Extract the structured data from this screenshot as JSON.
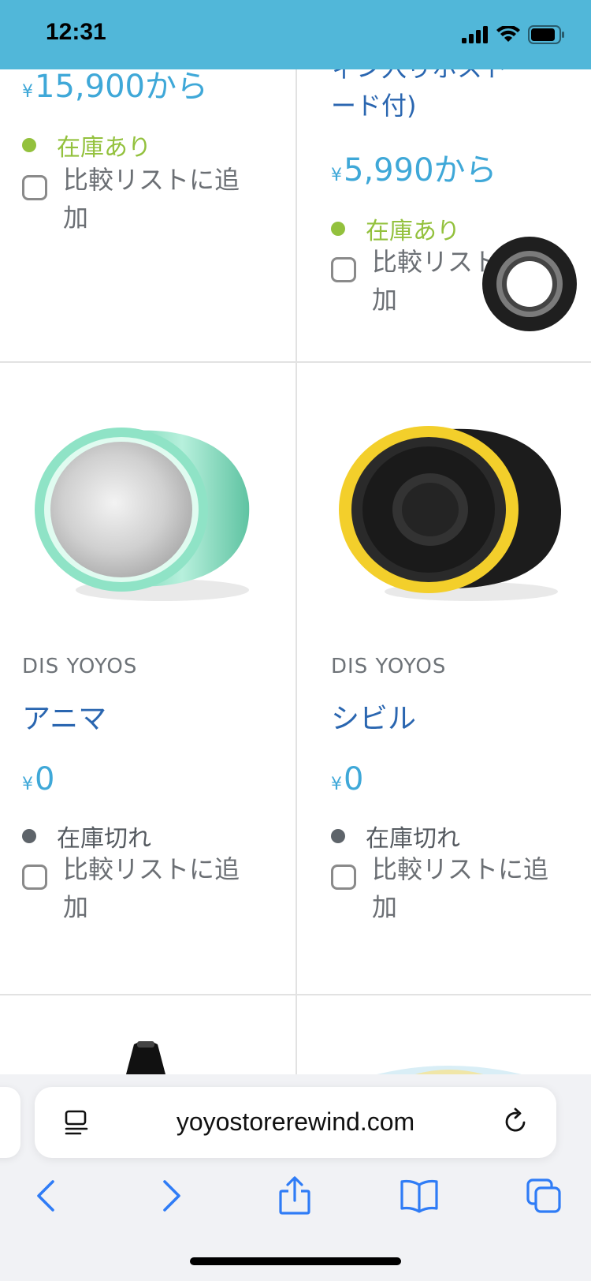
{
  "status_bar": {
    "time": "12:31"
  },
  "products": {
    "top_left": {
      "price_symbol": "¥",
      "price": "15,900から",
      "stock": "在庫あり",
      "compare_label": "比較リストに追加"
    },
    "top_right": {
      "name_partial_line1": "ィン入りホスト",
      "name_partial_line2": "ード付)",
      "price_symbol": "¥",
      "price": "5,990から",
      "stock": "在庫あり",
      "compare_label": "比較リストに追加"
    },
    "middle_left": {
      "brand": "DIS YOYOS",
      "name": "アニマ",
      "price_symbol": "¥",
      "price": "0",
      "stock": "在庫切れ",
      "compare_label": "比較リストに追加"
    },
    "middle_right": {
      "brand": "DIS YOYOS",
      "name": "シビル",
      "price_symbol": "¥",
      "price": "0",
      "stock": "在庫切れ",
      "compare_label": "比較リストに追加"
    }
  },
  "browser": {
    "url": "yoyostorerewind.com"
  },
  "icons": {
    "reader": "reader-mode-icon",
    "reload": "reload-icon",
    "back": "back-chevron-icon",
    "forward": "forward-chevron-icon",
    "share": "share-icon",
    "bookmarks": "bookmarks-icon",
    "tabs": "tabs-icon"
  },
  "colors": {
    "status_bar": "#51b7d9",
    "price": "#3fa8d8",
    "in_stock": "#93c13d",
    "out_of_stock": "#5e646a",
    "product_name": "#2a66b0",
    "toolbar_icon": "#2f7cf6"
  }
}
